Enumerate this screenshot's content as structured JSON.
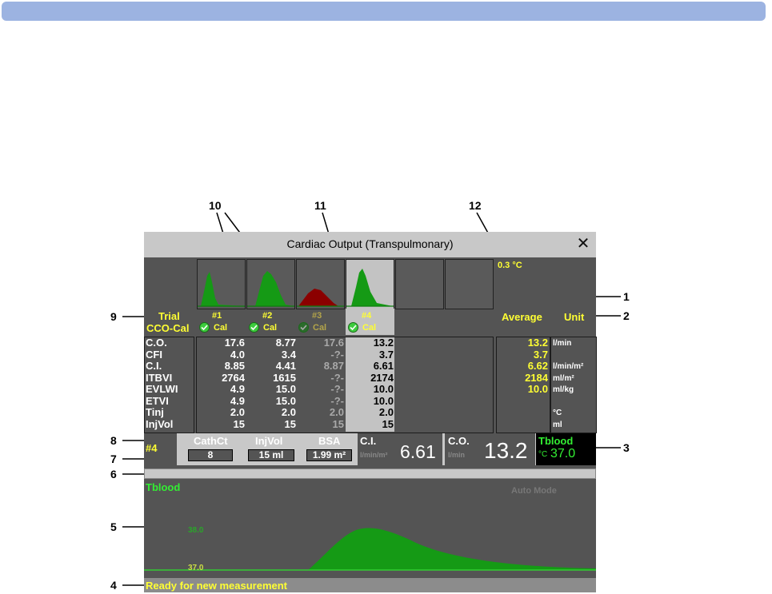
{
  "window": {
    "title": "Cardiac Output (Transpulmonary)",
    "close_label": "✕"
  },
  "header": {
    "temp_readout": "0.3 °C"
  },
  "trials": {
    "trial_label": "Trial",
    "cco_cal_label": "CCO-Cal",
    "average_label": "Average",
    "unit_label": "Unit",
    "items": [
      {
        "label": "#1",
        "cal": "Cal",
        "state": "accepted"
      },
      {
        "label": "#2",
        "cal": "Cal",
        "state": "accepted"
      },
      {
        "label": "#3",
        "cal": "Cal",
        "state": "rejected"
      },
      {
        "label": "#4",
        "cal": "Cal",
        "state": "accepted"
      }
    ]
  },
  "results": {
    "params": [
      "C.O.",
      "CFI",
      "C.I.",
      "ITBVI",
      "EVLWI",
      "ETVI",
      "Tinj",
      "InjVol"
    ],
    "trial1": [
      "17.6",
      "4.0",
      "8.85",
      "2764",
      "4.9",
      "4.9",
      "2.0",
      "15"
    ],
    "trial2": [
      "8.77",
      "3.4",
      "4.41",
      "1615",
      "15.0",
      "15.0",
      "2.0",
      "15"
    ],
    "trial3": [
      "17.6",
      "-?-",
      "8.87",
      "-?-",
      "-?-",
      "-?-",
      "2.0",
      "15"
    ],
    "trial4": [
      "13.2",
      "3.7",
      "6.61",
      "2174",
      "10.0",
      "10.0",
      "2.0",
      "15"
    ],
    "average": [
      "13.2",
      "3.7",
      "6.62",
      "2184",
      "10.0",
      "",
      "",
      ""
    ],
    "units": [
      "l/min",
      "",
      "l/min/m²",
      "ml/m²",
      "ml/kg",
      "",
      "°C",
      "ml"
    ]
  },
  "bottom": {
    "trial_num": "#4",
    "cathct_label": "CathCt",
    "cathct_value": "8",
    "injvol_label": "InjVol",
    "injvol_value": "15 ml",
    "bsa_label": "BSA",
    "bsa_value": "1.99 m²",
    "ci_label": "C.I.",
    "ci_unit": "l/min/m²",
    "ci_value": "6.61",
    "co_label": "C.O.",
    "co_unit": "l/min",
    "co_value": "13.2",
    "tblood_label": "Tblood",
    "tblood_unit": "°C",
    "tblood_value": "37.0"
  },
  "curve": {
    "label": "Tblood",
    "mode": "Auto Mode",
    "y_upper": "38.0",
    "y_lower": "37.0",
    "status": "Ready for new measurement"
  },
  "callouts": {
    "c1": "1",
    "c2": "2",
    "c3": "3",
    "c4": "4",
    "c5": "5",
    "c6": "6",
    "c7": "7",
    "c8": "8",
    "c9": "9",
    "c10": "10",
    "c11": "11",
    "c12": "12"
  },
  "colors": {
    "accent_yellow": "#ffff33",
    "curve_green": "#159a15",
    "rejected_red": "#8b0000",
    "panel_gray": "#545454"
  }
}
